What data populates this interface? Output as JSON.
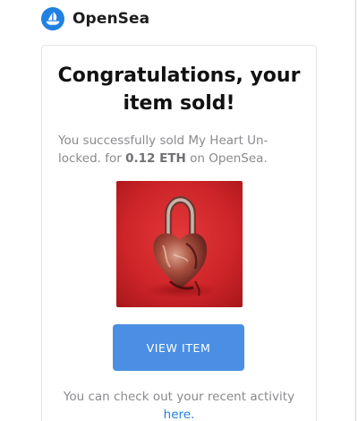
{
  "colors": {
    "brand_blue": "#2081e2",
    "button_blue": "#4a8fe3",
    "muted_text": "#8a8a8e",
    "title_text": "#111111"
  },
  "header": {
    "logo_icon": "opensea-sailboat-icon",
    "brand_name": "OpenSea"
  },
  "email": {
    "title": "Congratulations, your item sold!",
    "message_prefix": "You successfully sold My Heart Un-locked. for ",
    "price": "0.12 ETH",
    "message_suffix": " on OpenSea.",
    "image_icon": "nft-artwork-image",
    "button_label": "VIEW ITEM",
    "footer_prefix": "You can check out your recent activity ",
    "footer_link": "here."
  }
}
